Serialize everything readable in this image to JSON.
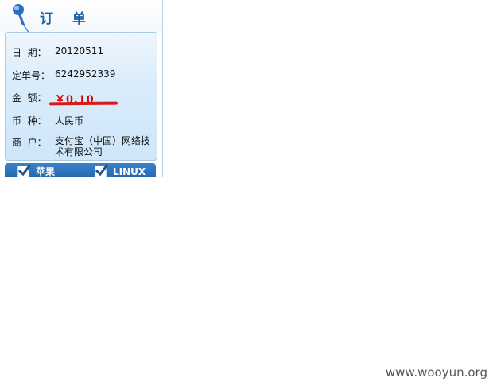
{
  "panel": {
    "title": "订 单"
  },
  "order": {
    "date": {
      "label": "日  期：",
      "value": "20120511"
    },
    "order_no": {
      "label": "定单号：",
      "value": "6242952339"
    },
    "amount": {
      "label": "金  额：",
      "value": "￥0.10"
    },
    "currency": {
      "label": "币  种：",
      "value": "人民币"
    },
    "merchant": {
      "label": "商  户：",
      "value": "支付宝（中国）网络技术有限公司"
    }
  },
  "options": [
    {
      "label": "苹果",
      "checked": true
    },
    {
      "label": "LINUX",
      "checked": true
    }
  ],
  "watermark": "www.wooyun.org",
  "colors": {
    "title": "#1a5fa6",
    "amount": "#e00000",
    "underline": "#d81a1a",
    "bar": "#2a6fb8"
  },
  "icons": {
    "pin": "pushpin-icon",
    "check": "checkbox-checked-icon"
  }
}
